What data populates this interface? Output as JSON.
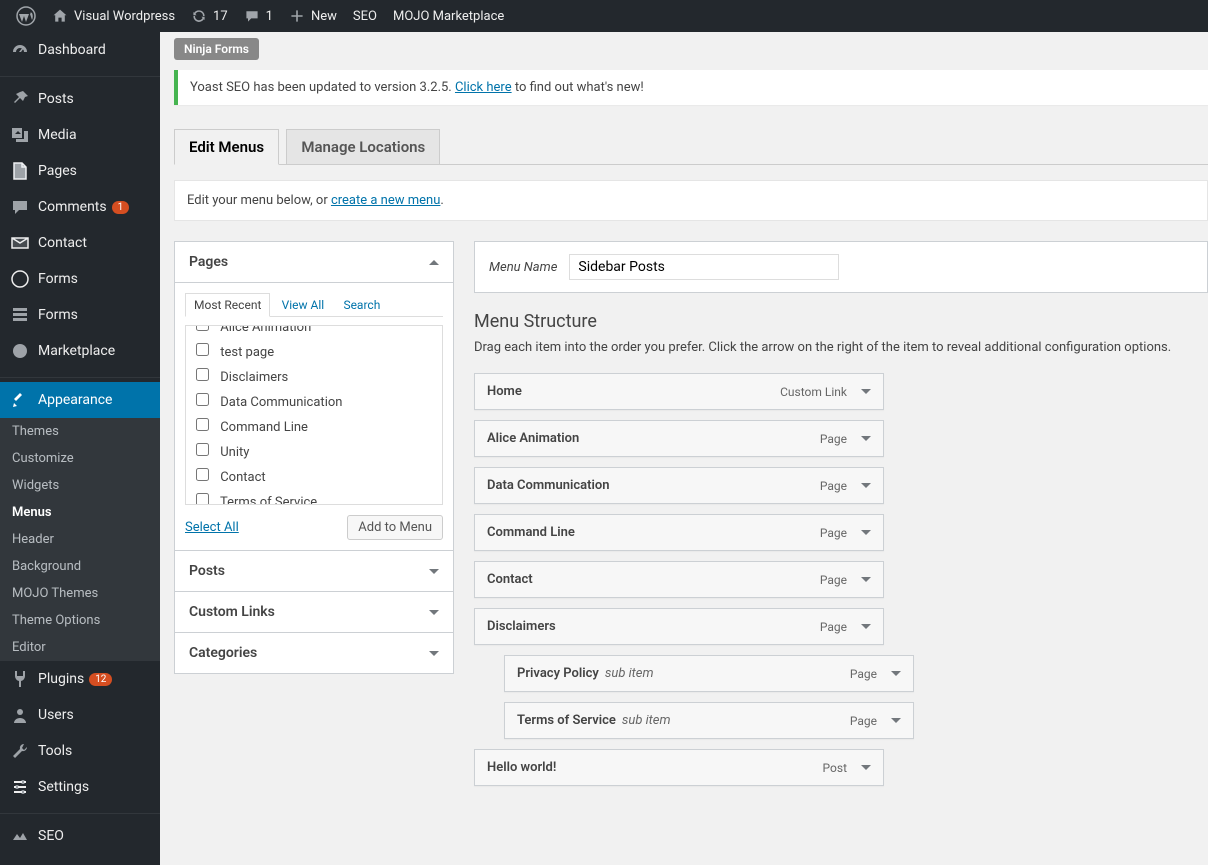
{
  "adminbar": {
    "site_title": "Visual Wordpress",
    "updates": "17",
    "comments": "1",
    "new": "New",
    "seo": "SEO",
    "mojo": "MOJO Marketplace"
  },
  "sidebar": {
    "dashboard": "Dashboard",
    "items": [
      {
        "label": "Posts",
        "icon": "pin"
      },
      {
        "label": "Media",
        "icon": "media"
      },
      {
        "label": "Pages",
        "icon": "pages"
      },
      {
        "label": "Comments",
        "icon": "comment",
        "badge": "1"
      },
      {
        "label": "Contact",
        "icon": "contact"
      },
      {
        "label": "Forms",
        "icon": "forms"
      },
      {
        "label": "Forms",
        "icon": "forms2"
      },
      {
        "label": "Marketplace",
        "icon": "marketplace"
      },
      {
        "label": "Appearance",
        "icon": "appearance",
        "current": true
      },
      {
        "label": "Plugins",
        "icon": "plugins",
        "badge": "12"
      },
      {
        "label": "Users",
        "icon": "users"
      },
      {
        "label": "Tools",
        "icon": "tools"
      },
      {
        "label": "Settings",
        "icon": "settings"
      },
      {
        "label": "SEO",
        "icon": "seo"
      }
    ],
    "appearance_sub": [
      "Themes",
      "Customize",
      "Widgets",
      "Menus",
      "Header",
      "Background",
      "MOJO Themes",
      "Theme Options",
      "Editor"
    ],
    "current_sub": "Menus"
  },
  "content": {
    "ninja": "Ninja Forms",
    "notice_pre": "Yoast SEO has been updated to version 3.2.5. ",
    "notice_link": "Click here",
    "notice_post": " to find out what's new!",
    "tabs": {
      "edit": "Edit Menus",
      "locations": "Manage Locations"
    },
    "manage_pre": "Edit your menu below, or ",
    "manage_link": "create a new menu",
    "accordions": {
      "pages": "Pages",
      "posts": "Posts",
      "custom": "Custom Links",
      "categories": "Categories"
    },
    "inner_tabs": {
      "recent": "Most Recent",
      "all": "View All",
      "search": "Search"
    },
    "page_list": [
      "Alice Animation",
      "test page",
      "Disclaimers",
      "Data Communication",
      "Command Line",
      "Unity",
      "Contact",
      "Terms of Service"
    ],
    "select_all": "Select All",
    "add_to_menu": "Add to Menu",
    "menu_name_label": "Menu Name",
    "menu_name_value": "Sidebar Posts",
    "structure_heading": "Menu Structure",
    "structure_desc": "Drag each item into the order you prefer. Click the arrow on the right of the item to reveal additional configuration options.",
    "subitem_label": "sub item",
    "menu_items": [
      {
        "title": "Home",
        "type": "Custom Link",
        "sub": false
      },
      {
        "title": "Alice Animation",
        "type": "Page",
        "sub": false
      },
      {
        "title": "Data Communication",
        "type": "Page",
        "sub": false
      },
      {
        "title": "Command Line",
        "type": "Page",
        "sub": false
      },
      {
        "title": "Contact",
        "type": "Page",
        "sub": false
      },
      {
        "title": "Disclaimers",
        "type": "Page",
        "sub": false
      },
      {
        "title": "Privacy Policy",
        "type": "Page",
        "sub": true
      },
      {
        "title": "Terms of Service",
        "type": "Page",
        "sub": true
      },
      {
        "title": "Hello world!",
        "type": "Post",
        "sub": false
      }
    ]
  }
}
